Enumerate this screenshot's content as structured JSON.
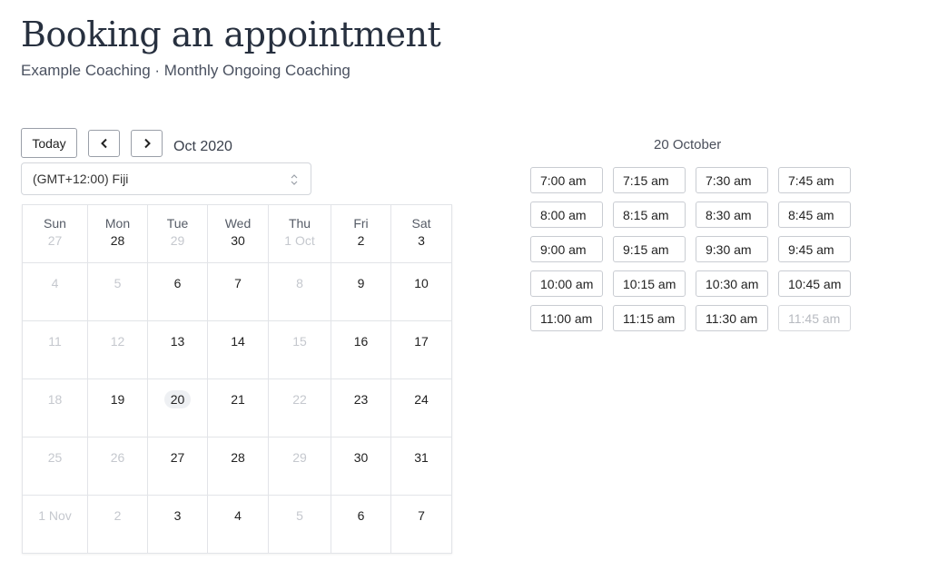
{
  "header": {
    "title": "Booking an appointment",
    "subtitle": "Example Coaching · Monthly Ongoing Coaching"
  },
  "toolbar": {
    "today_label": "Today",
    "prev_icon": "chevron-left-icon",
    "next_icon": "chevron-right-icon",
    "month_label": "Oct 2020"
  },
  "timezone": {
    "selected": "(GMT+12:00) Fiji",
    "icon": "select-updown-icon"
  },
  "calendar": {
    "weekdays": [
      "Sun",
      "Mon",
      "Tue",
      "Wed",
      "Thu",
      "Fri",
      "Sat"
    ],
    "selected_date": "20",
    "weeks": [
      [
        {
          "label": "27",
          "available": false
        },
        {
          "label": "28",
          "available": true
        },
        {
          "label": "29",
          "available": false
        },
        {
          "label": "30",
          "available": true
        },
        {
          "label": "1 Oct",
          "available": false
        },
        {
          "label": "2",
          "available": true
        },
        {
          "label": "3",
          "available": true
        }
      ],
      [
        {
          "label": "4",
          "available": false
        },
        {
          "label": "5",
          "available": false
        },
        {
          "label": "6",
          "available": true
        },
        {
          "label": "7",
          "available": true
        },
        {
          "label": "8",
          "available": false
        },
        {
          "label": "9",
          "available": true
        },
        {
          "label": "10",
          "available": true
        }
      ],
      [
        {
          "label": "11",
          "available": false
        },
        {
          "label": "12",
          "available": false
        },
        {
          "label": "13",
          "available": true
        },
        {
          "label": "14",
          "available": true
        },
        {
          "label": "15",
          "available": false
        },
        {
          "label": "16",
          "available": true
        },
        {
          "label": "17",
          "available": true
        }
      ],
      [
        {
          "label": "18",
          "available": false
        },
        {
          "label": "19",
          "available": true
        },
        {
          "label": "20",
          "available": true,
          "selected": true
        },
        {
          "label": "21",
          "available": true
        },
        {
          "label": "22",
          "available": false
        },
        {
          "label": "23",
          "available": true
        },
        {
          "label": "24",
          "available": true
        }
      ],
      [
        {
          "label": "25",
          "available": false
        },
        {
          "label": "26",
          "available": false
        },
        {
          "label": "27",
          "available": true
        },
        {
          "label": "28",
          "available": true
        },
        {
          "label": "29",
          "available": false
        },
        {
          "label": "30",
          "available": true
        },
        {
          "label": "31",
          "available": true
        }
      ],
      [
        {
          "label": "1 Nov",
          "available": false
        },
        {
          "label": "2",
          "available": false
        },
        {
          "label": "3",
          "available": true
        },
        {
          "label": "4",
          "available": true
        },
        {
          "label": "5",
          "available": false
        },
        {
          "label": "6",
          "available": true
        },
        {
          "label": "7",
          "available": true
        }
      ]
    ]
  },
  "slots": {
    "title": "20 October",
    "times": [
      {
        "label": "7:00 am",
        "available": true
      },
      {
        "label": "7:15 am",
        "available": true
      },
      {
        "label": "7:30 am",
        "available": true
      },
      {
        "label": "7:45 am",
        "available": true
      },
      {
        "label": "8:00 am",
        "available": true
      },
      {
        "label": "8:15 am",
        "available": true
      },
      {
        "label": "8:30 am",
        "available": true
      },
      {
        "label": "8:45 am",
        "available": true
      },
      {
        "label": "9:00 am",
        "available": true
      },
      {
        "label": "9:15 am",
        "available": true
      },
      {
        "label": "9:30 am",
        "available": true
      },
      {
        "label": "9:45 am",
        "available": true
      },
      {
        "label": "10:00 am",
        "available": true
      },
      {
        "label": "10:15 am",
        "available": true
      },
      {
        "label": "10:30 am",
        "available": true
      },
      {
        "label": "10:45 am",
        "available": true
      },
      {
        "label": "11:00 am",
        "available": true
      },
      {
        "label": "11:15 am",
        "available": true
      },
      {
        "label": "11:30 am",
        "available": true
      },
      {
        "label": "11:45 am",
        "available": false
      }
    ]
  }
}
